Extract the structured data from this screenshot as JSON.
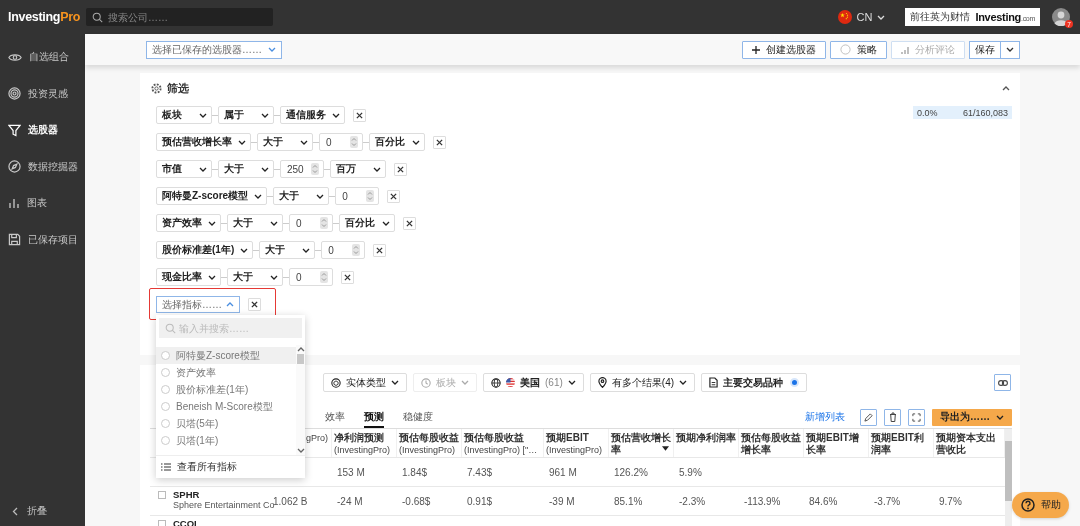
{
  "header": {
    "logo": {
      "brand": "Investing",
      "accent": "Pro"
    },
    "search": {
      "placeholder": "搜索公司……"
    },
    "region": "CN",
    "site_link": {
      "label": "前往英为财情",
      "brand": "Investing",
      "suffix": ".com"
    },
    "notifications": "7"
  },
  "sidebar": {
    "items": [
      {
        "label": "自选组合",
        "selected": false
      },
      {
        "label": "投资灵感",
        "selected": false
      },
      {
        "label": "选股器",
        "selected": true
      },
      {
        "label": "数据挖掘器",
        "selected": false
      },
      {
        "label": "图表",
        "selected": false
      },
      {
        "label": "已保存项目",
        "selected": false
      }
    ],
    "collapse": "折叠"
  },
  "toolbar": {
    "saved_screener": {
      "placeholder": "选择已保存的选股器……"
    },
    "buttons": [
      {
        "label": "创建选股器",
        "disabled": false
      },
      {
        "label": "策略",
        "disabled": false
      },
      {
        "label": "分析评论",
        "disabled": true
      }
    ],
    "save": "保存"
  },
  "filters": {
    "title": "筛选",
    "expanded": true,
    "progress": {
      "percent": "0.0%",
      "count": "61/160,083",
      "level": 0
    },
    "rows": [
      {
        "fields": [
          {
            "kind": "select",
            "value": "板块"
          },
          {
            "kind": "select",
            "value": "属于"
          },
          {
            "kind": "select",
            "value": "通信服务"
          }
        ]
      },
      {
        "fields": [
          {
            "kind": "select",
            "value": "预估营收增长率"
          },
          {
            "kind": "select",
            "value": "大于"
          },
          {
            "kind": "number",
            "value": "0"
          },
          {
            "kind": "select",
            "value": "百分比"
          }
        ]
      },
      {
        "fields": [
          {
            "kind": "select",
            "value": "市值"
          },
          {
            "kind": "select",
            "value": "大于"
          },
          {
            "kind": "number",
            "value": "250"
          },
          {
            "kind": "select",
            "value": "百万"
          }
        ]
      },
      {
        "fields": [
          {
            "kind": "select",
            "value": "阿特曼Z-score模型"
          },
          {
            "kind": "select",
            "value": "大于"
          },
          {
            "kind": "number",
            "value": "0"
          }
        ]
      },
      {
        "fields": [
          {
            "kind": "select",
            "value": "资产效率"
          },
          {
            "kind": "select",
            "value": "大于"
          },
          {
            "kind": "number",
            "value": "0"
          },
          {
            "kind": "select",
            "value": "百分比"
          }
        ]
      },
      {
        "fields": [
          {
            "kind": "select",
            "value": "股价标准差(1年)"
          },
          {
            "kind": "select",
            "value": "大于"
          },
          {
            "kind": "number",
            "value": "0"
          }
        ]
      },
      {
        "fields": [
          {
            "kind": "select",
            "value": "现金比率"
          },
          {
            "kind": "select",
            "value": "大于"
          },
          {
            "kind": "number",
            "value": "0"
          }
        ]
      }
    ],
    "new_metric": {
      "placeholder": "选择指标……",
      "highlighted": true,
      "open": true
    }
  },
  "metric_menu": {
    "search": {
      "placeholder": "输入并搜索……"
    },
    "options": [
      {
        "label": "阿特曼Z-score模型",
        "selected": false,
        "hovered": true
      },
      {
        "label": "资产效率",
        "selected": false,
        "hovered": false
      },
      {
        "label": "股价标准差(1年)",
        "selected": false,
        "hovered": false
      },
      {
        "label": "Beneish M-Score模型",
        "selected": false,
        "hovered": false
      },
      {
        "label": "贝塔(5年)",
        "selected": false,
        "hovered": false
      },
      {
        "label": "贝塔(1年)",
        "selected": false,
        "hovered": false
      }
    ],
    "footer": "查看所有指标"
  },
  "results": {
    "chips": [
      {
        "kind": "select",
        "label": "实体类型",
        "disabled": false
      },
      {
        "kind": "select",
        "label": "板块",
        "disabled": true
      },
      {
        "kind": "select",
        "label": "美国",
        "count": "(61)",
        "disabled": false
      },
      {
        "kind": "select",
        "label": "有多个结果(4)",
        "disabled": false
      },
      {
        "kind": "toggle",
        "label": "主要交易品种",
        "on": true
      }
    ],
    "tabs": [
      {
        "label": "效率",
        "selected": false
      },
      {
        "label": "预测",
        "selected": true
      },
      {
        "label": "稳健度",
        "selected": false
      }
    ],
    "add_list": "新增列表",
    "export": "导出为……",
    "columns": [
      {
        "sub": "gPro)"
      },
      {
        "label": "净利润预测",
        "sub": "(InvestingPro)"
      },
      {
        "label": "预估每股收益",
        "sub": "(InvestingPro)"
      },
      {
        "label": "预估每股收益",
        "sub": "(InvestingPro) [\"…"
      },
      {
        "label": "预期EBIT",
        "sub": "(InvestingPro)"
      },
      {
        "label": "预估营收增长率",
        "sorted": true
      },
      {
        "label": "预期净利润率"
      },
      {
        "label": "预估每股收益增长率"
      },
      {
        "label": "预期EBIT增长率"
      },
      {
        "label": "预期EBIT利润率"
      },
      {
        "label": "预期资本支出营收比"
      }
    ],
    "rows": [
      {
        "cells": [
          null,
          "153 M",
          "1.84$",
          "7.43$",
          "961 M",
          "126.2%",
          "5.9%",
          null,
          null,
          null,
          null
        ]
      },
      {
        "ticker": "SPHR",
        "name": "Sphere Entertainment Co",
        "checked": false,
        "cells": [
          "1.062 B",
          "-24 M",
          "-0.68$",
          "0.91$",
          "-39 M",
          "85.1%",
          "-2.3%",
          "-113.9%",
          "84.6%",
          "-3.7%",
          "9.7%"
        ]
      },
      {
        "ticker": "CCOI",
        "checked": false
      }
    ]
  },
  "help": "帮助"
}
